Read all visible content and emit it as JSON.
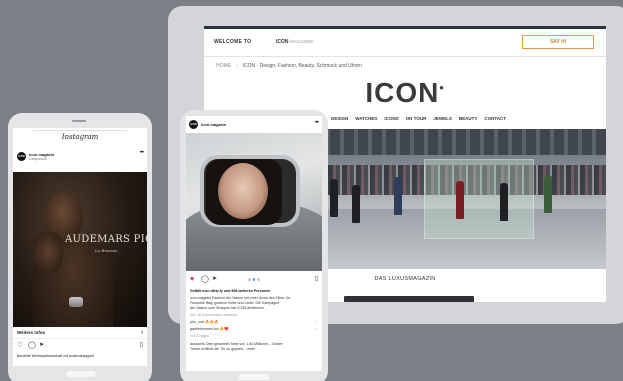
{
  "website": {
    "welcome": "WELCOME TO",
    "logo_small_bold": "ICON",
    "logo_small_light": "MAGAZINE",
    "cta": "SAY HI",
    "breadcrumb_home": "HOME",
    "breadcrumb_sep": "›",
    "breadcrumb_current": "ICON - Design, Fashion, Beauty, Schmuck und Uhren",
    "logo": "ICON",
    "logo_mark": "•",
    "nav": [
      "FASHION",
      "DESIGN",
      "WATCHES",
      "ICONS",
      "ON TOUR",
      "JEWELS",
      "BEAUTY",
      "CONTACT"
    ],
    "tagline": "DAS LUXUSMAGAZIN"
  },
  "phone1": {
    "app_title": "Instagram",
    "account": "icon.magazin",
    "account_sub": "Gesponsert",
    "avatar": "ICON",
    "brand_line1": "AUDEMARS PIGUET",
    "brand_line2": "Le Brassus",
    "more_label": "Weitere Infos",
    "liked_by": "Bezahlte Werbepartnerschaft mit audemarspiguet"
  },
  "phone2": {
    "account": "icon.magazin",
    "avatar": "ICON",
    "caption_lines": [
      "Gefällt icon.dietz.ly und 908 weiteren Personen",
      "icon.magazin Fashion der Saison mit einer Ikone des Films. Ihr",
      "Favourite Bag: goldene Kette und Leder. Die Kampagne",
      "der Saison zum Shoppen bei ICON.de/fashion",
      "Alle 18 Kommentare ansehen",
      "phv_cozi 🔥🔥🔥",
      "gabrieleromeo.fux 🔥❤️",
      "vor 2 Tagen",
      "aussichts Dein gesamtes Nest von 1,84 Millionen  – Dieser",
      "Traum eröffnet die Tür  zu geplant...  mehr"
    ]
  },
  "colors": {
    "background": "#7c7f86",
    "accent": "#d1842e",
    "like": "#e0245e"
  }
}
